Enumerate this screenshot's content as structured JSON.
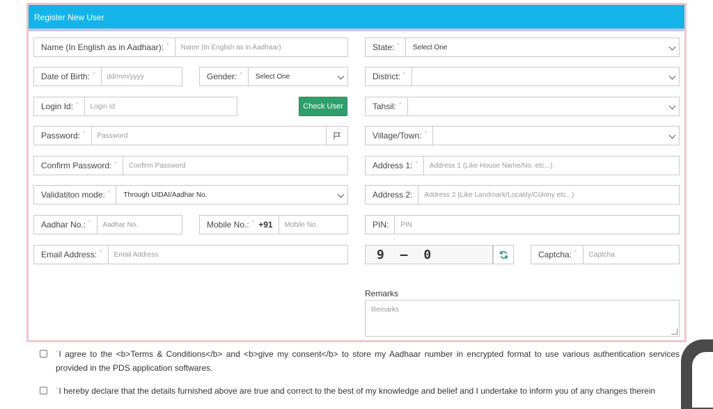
{
  "header": {
    "title": "Register New User"
  },
  "left": {
    "name_label": "Name (In English as in Aadhaar):",
    "name_placeholder": "Name (In English as in Aadhaar)",
    "dob_label": "Date of Birth:",
    "dob_placeholder": "dd/mm/yyyy",
    "gender_label": "Gender:",
    "gender_value": "Select One",
    "login_label": "Login Id:",
    "login_placeholder": "Login Id",
    "check_user_label": "Check User",
    "password_label": "Password:",
    "password_placeholder": "Password",
    "confirm_label": "Confirm Password:",
    "confirm_placeholder": "Confirm Password",
    "validation_label": "Validatiton mode:",
    "validation_value": "Through UIDAI/Aadhar No.",
    "aadhar_label": "Aadhar No.:",
    "aadhar_placeholder": "Aadhar No.",
    "mobile_label": "Mobile No.:",
    "mobile_prefix": "+91",
    "mobile_placeholder": "Mobile No.",
    "email_label": "Email Address:",
    "email_placeholder": "Email Address"
  },
  "right": {
    "state_label": "State:",
    "state_value": "Select One",
    "district_label": "District:",
    "district_value": "",
    "tahsil_label": "Tahsil:",
    "tahsil_value": "",
    "village_label": "Village/Town:",
    "village_value": "",
    "address1_label": "Address 1:",
    "address1_placeholder": "Address 1 (Like House Name/No. etc...)",
    "address2_label": "Address 2:",
    "address2_placeholder": "Address 2 (Like Landmark/Locality/Colony etc...)",
    "pin_label": "PIN:",
    "pin_placeholder": "PIN",
    "captcha_text": "9 – 0",
    "captcha_label": "Captcha:",
    "captcha_placeholder": "Captcha",
    "remarks_label": "Remarks",
    "remarks_placeholder": "Remarks"
  },
  "required_mark": "*",
  "consent": {
    "terms": "I agree to the <b>Terms & Conditions</b> and <b>give my consent</b> to store my Aadhaar number in encrypted format to use various authentication services provided in the PDS application softwares.",
    "declaration": "I hereby declare that the details furnished above are true and correct to the best of my knowledge and belief and I undertake to inform you of any changes therein"
  },
  "icons": {
    "flag": "flag-icon",
    "refresh": "refresh-icon",
    "chevron": "chevron-down-icon"
  },
  "colors": {
    "header": "#14b4ea",
    "button": "#2f9e6d",
    "panel_border": "#f0c7cc"
  }
}
